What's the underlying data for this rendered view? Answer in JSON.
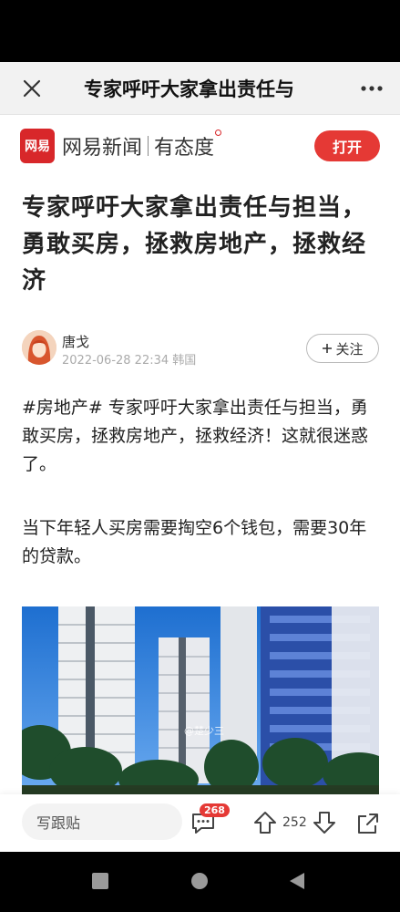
{
  "topbar": {
    "close_icon": "close-icon",
    "title": "专家呼吁大家拿出责任与",
    "more_icon": "more-dots-icon"
  },
  "brand": {
    "logo_text": "网易",
    "name": "网易新闻",
    "slogan": "有态度",
    "open_label": "打开",
    "accent_color": "#e53935"
  },
  "article": {
    "headline": "专家呼吁大家拿出责任与担当，勇敢买房，拯救房地产，拯救经济",
    "author": "唐戈",
    "meta": "2022-06-28 22:34 韩国",
    "follow_label": "关注",
    "paragraphs": [
      "#房地产# 专家呼吁大家拿出责任与担当，勇敢买房，拯救房地产，拯救经济！这就很迷惑了。",
      "当下年轻人买房需要掏空6个钱包，需要30年的贷款。"
    ],
    "image_watermark": "@楚少三"
  },
  "bottom_bar": {
    "reply_placeholder": "写跟贴",
    "comment_count": "268",
    "vote_count": "252",
    "icons": [
      "comment-icon",
      "upvote-icon",
      "downvote-icon",
      "share-icon"
    ]
  },
  "nav": {
    "icons": [
      "recent-apps-icon",
      "home-icon",
      "back-icon"
    ]
  }
}
